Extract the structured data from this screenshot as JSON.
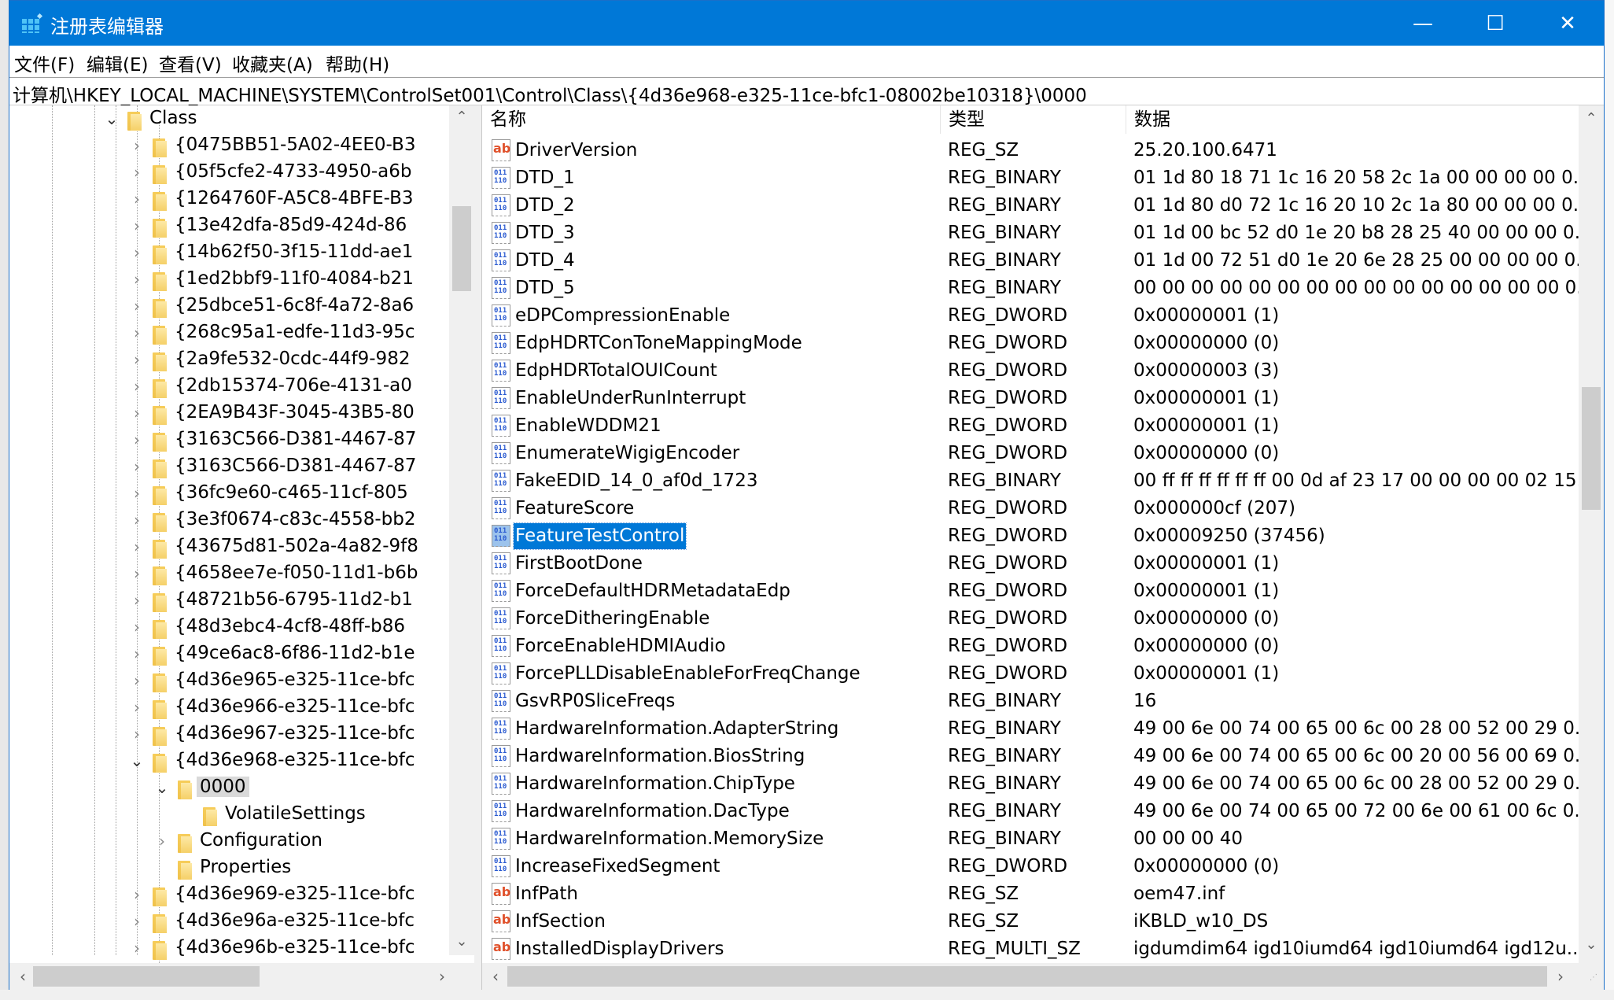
{
  "window": {
    "title": "注册表编辑器",
    "app_icon": "registry-editor-icon",
    "controls": {
      "minimize": "—",
      "maximize": "☐",
      "close": "✕"
    }
  },
  "menu": [
    {
      "label": "文件(F)"
    },
    {
      "label": "编辑(E)"
    },
    {
      "label": "查看(V)"
    },
    {
      "label": "收藏夹(A)"
    },
    {
      "label": "帮助(H)"
    }
  ],
  "address": "计算机\\HKEY_LOCAL_MACHINE\\SYSTEM\\ControlSet001\\Control\\Class\\{4d36e968-e325-11ce-bfc1-08002be10318}\\0000",
  "tree": {
    "items": [
      {
        "label": "Class",
        "level": 0,
        "state": "expanded"
      },
      {
        "label": "{0475BB51-5A02-4EE0-B3",
        "level": 1,
        "state": "collapsed"
      },
      {
        "label": "{05f5cfe2-4733-4950-a6b",
        "level": 1,
        "state": "collapsed"
      },
      {
        "label": "{1264760F-A5C8-4BFE-B3",
        "level": 1,
        "state": "collapsed"
      },
      {
        "label": "{13e42dfa-85d9-424d-86",
        "level": 1,
        "state": "collapsed"
      },
      {
        "label": "{14b62f50-3f15-11dd-ae1",
        "level": 1,
        "state": "collapsed"
      },
      {
        "label": "{1ed2bbf9-11f0-4084-b21",
        "level": 1,
        "state": "collapsed"
      },
      {
        "label": "{25dbce51-6c8f-4a72-8a6",
        "level": 1,
        "state": "collapsed"
      },
      {
        "label": "{268c95a1-edfe-11d3-95c",
        "level": 1,
        "state": "collapsed"
      },
      {
        "label": "{2a9fe532-0cdc-44f9-982",
        "level": 1,
        "state": "collapsed"
      },
      {
        "label": "{2db15374-706e-4131-a0",
        "level": 1,
        "state": "collapsed"
      },
      {
        "label": "{2EA9B43F-3045-43B5-80",
        "level": 1,
        "state": "collapsed"
      },
      {
        "label": "{3163C566-D381-4467-87",
        "level": 1,
        "state": "collapsed"
      },
      {
        "label": "{3163C566-D381-4467-87",
        "level": 1,
        "state": "collapsed"
      },
      {
        "label": "{36fc9e60-c465-11cf-805",
        "level": 1,
        "state": "collapsed"
      },
      {
        "label": "{3e3f0674-c83c-4558-bb2",
        "level": 1,
        "state": "collapsed"
      },
      {
        "label": "{43675d81-502a-4a82-9f8",
        "level": 1,
        "state": "collapsed"
      },
      {
        "label": "{4658ee7e-f050-11d1-b6b",
        "level": 1,
        "state": "collapsed"
      },
      {
        "label": "{48721b56-6795-11d2-b1",
        "level": 1,
        "state": "collapsed"
      },
      {
        "label": "{48d3ebc4-4cf8-48ff-b86",
        "level": 1,
        "state": "collapsed"
      },
      {
        "label": "{49ce6ac8-6f86-11d2-b1e",
        "level": 1,
        "state": "collapsed"
      },
      {
        "label": "{4d36e965-e325-11ce-bfc",
        "level": 1,
        "state": "collapsed"
      },
      {
        "label": "{4d36e966-e325-11ce-bfc",
        "level": 1,
        "state": "collapsed"
      },
      {
        "label": "{4d36e967-e325-11ce-bfc",
        "level": 1,
        "state": "collapsed"
      },
      {
        "label": "{4d36e968-e325-11ce-bfc",
        "level": 1,
        "state": "expanded"
      },
      {
        "label": "0000",
        "level": 2,
        "state": "expanded",
        "selected": true
      },
      {
        "label": "VolatileSettings",
        "level": 3,
        "state": "leaf"
      },
      {
        "label": "Configuration",
        "level": 2,
        "state": "collapsed"
      },
      {
        "label": "Properties",
        "level": 2,
        "state": "leaf"
      },
      {
        "label": "{4d36e969-e325-11ce-bfc",
        "level": 1,
        "state": "collapsed"
      },
      {
        "label": "{4d36e96a-e325-11ce-bfc",
        "level": 1,
        "state": "collapsed"
      },
      {
        "label": "{4d36e96b-e325-11ce-bfc",
        "level": 1,
        "state": "collapsed"
      }
    ]
  },
  "list": {
    "columns": {
      "name": "名称",
      "type": "类型",
      "data": "数据"
    },
    "rows": [
      {
        "icon": "string",
        "name": "DriverVersion",
        "type": "REG_SZ",
        "data": "25.20.100.6471"
      },
      {
        "icon": "binary",
        "name": "DTD_1",
        "type": "REG_BINARY",
        "data": "01 1d 80 18 71 1c 16 20 58 2c 1a 00 00 00 00 0..."
      },
      {
        "icon": "binary",
        "name": "DTD_2",
        "type": "REG_BINARY",
        "data": "01 1d 80 d0 72 1c 16 20 10 2c 1a 80 00 00 00 0..."
      },
      {
        "icon": "binary",
        "name": "DTD_3",
        "type": "REG_BINARY",
        "data": "01 1d 00 bc 52 d0 1e 20 b8 28 25 40 00 00 00 0..."
      },
      {
        "icon": "binary",
        "name": "DTD_4",
        "type": "REG_BINARY",
        "data": "01 1d 00 72 51 d0 1e 20 6e 28 25 00 00 00 00 0..."
      },
      {
        "icon": "binary",
        "name": "DTD_5",
        "type": "REG_BINARY",
        "data": "00 00 00 00 00 00 00 00 00 00 00 00 00 00 00 0..."
      },
      {
        "icon": "binary",
        "name": "eDPCompressionEnable",
        "type": "REG_DWORD",
        "data": "0x00000001 (1)"
      },
      {
        "icon": "binary",
        "name": "EdpHDRTConToneMappingMode",
        "type": "REG_DWORD",
        "data": "0x00000000 (0)"
      },
      {
        "icon": "binary",
        "name": "EdpHDRTotalOUICount",
        "type": "REG_DWORD",
        "data": "0x00000003 (3)"
      },
      {
        "icon": "binary",
        "name": "EnableUnderRunInterrupt",
        "type": "REG_DWORD",
        "data": "0x00000001 (1)"
      },
      {
        "icon": "binary",
        "name": "EnableWDDM21",
        "type": "REG_DWORD",
        "data": "0x00000001 (1)"
      },
      {
        "icon": "binary",
        "name": "EnumerateWigigEncoder",
        "type": "REG_DWORD",
        "data": "0x00000000 (0)"
      },
      {
        "icon": "binary",
        "name": "FakeEDID_14_0_af0d_1723",
        "type": "REG_BINARY",
        "data": "00 ff ff ff ff ff ff 00 0d af 23 17 00 00 00 00 02 15..."
      },
      {
        "icon": "binary",
        "name": "FeatureScore",
        "type": "REG_DWORD",
        "data": "0x000000cf (207)"
      },
      {
        "icon": "binary",
        "name": "FeatureTestControl",
        "type": "REG_DWORD",
        "data": "0x00009250 (37456)",
        "selected": true
      },
      {
        "icon": "binary",
        "name": "FirstBootDone",
        "type": "REG_DWORD",
        "data": "0x00000001 (1)"
      },
      {
        "icon": "binary",
        "name": "ForceDefaultHDRMetadataEdp",
        "type": "REG_DWORD",
        "data": "0x00000001 (1)"
      },
      {
        "icon": "binary",
        "name": "ForceDitheringEnable",
        "type": "REG_DWORD",
        "data": "0x00000000 (0)"
      },
      {
        "icon": "binary",
        "name": "ForceEnableHDMIAudio",
        "type": "REG_DWORD",
        "data": "0x00000000 (0)"
      },
      {
        "icon": "binary",
        "name": "ForcePLLDisableEnableForFreqChange",
        "type": "REG_DWORD",
        "data": "0x00000001 (1)"
      },
      {
        "icon": "binary",
        "name": "GsvRP0SliceFreqs",
        "type": "REG_BINARY",
        "data": "16"
      },
      {
        "icon": "binary",
        "name": "HardwareInformation.AdapterString",
        "type": "REG_BINARY",
        "data": "49 00 6e 00 74 00 65 00 6c 00 28 00 52 00 29 0..."
      },
      {
        "icon": "binary",
        "name": "HardwareInformation.BiosString",
        "type": "REG_BINARY",
        "data": "49 00 6e 00 74 00 65 00 6c 00 20 00 56 00 69 0..."
      },
      {
        "icon": "binary",
        "name": "HardwareInformation.ChipType",
        "type": "REG_BINARY",
        "data": "49 00 6e 00 74 00 65 00 6c 00 28 00 52 00 29 0..."
      },
      {
        "icon": "binary",
        "name": "HardwareInformation.DacType",
        "type": "REG_BINARY",
        "data": "49 00 6e 00 74 00 65 00 72 00 6e 00 61 00 6c 0..."
      },
      {
        "icon": "binary",
        "name": "HardwareInformation.MemorySize",
        "type": "REG_BINARY",
        "data": "00 00 00 40"
      },
      {
        "icon": "binary",
        "name": "IncreaseFixedSegment",
        "type": "REG_DWORD",
        "data": "0x00000000 (0)"
      },
      {
        "icon": "string",
        "name": "InfPath",
        "type": "REG_SZ",
        "data": "oem47.inf"
      },
      {
        "icon": "string",
        "name": "InfSection",
        "type": "REG_SZ",
        "data": "iKBLD_w10_DS"
      },
      {
        "icon": "string",
        "name": "InstalledDisplayDrivers",
        "type": "REG_MULTI_SZ",
        "data": "igdumdim64 igd10iumd64 igd10iumd64 igd12u..."
      }
    ]
  },
  "icons": {
    "string_glyph": "ab",
    "binary_glyph": "011\n110",
    "chevron_right": "›",
    "chevron_down": "⌄",
    "scroll_up": "⌃",
    "scroll_down": "⌄",
    "scroll_left": "‹",
    "scroll_right": "›"
  },
  "colors": {
    "titlebar": "#0078d7",
    "selection": "#0078d7",
    "tree_selection": "#d9d9d9",
    "string_icon": "#e0502a",
    "binary_icon": "#2a5ad0"
  }
}
